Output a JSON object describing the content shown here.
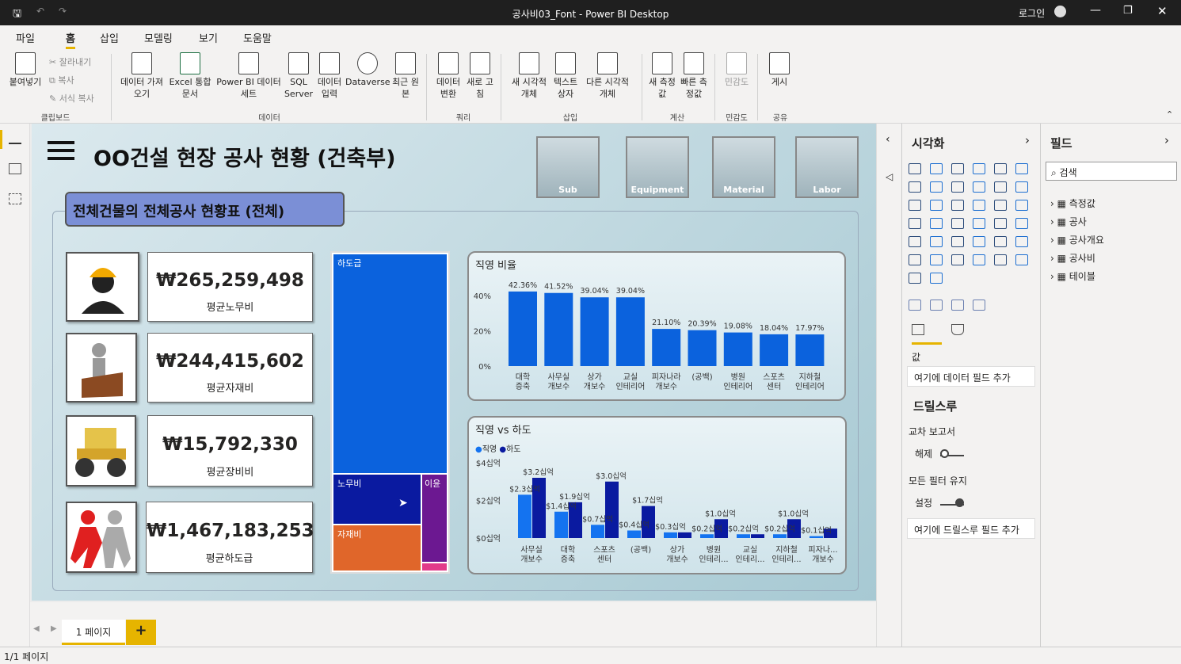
{
  "window": {
    "title": "공사비03_Font - Power BI Desktop",
    "login": "로그인"
  },
  "menu": [
    "파일",
    "홈",
    "삽입",
    "모델링",
    "보기",
    "도움말"
  ],
  "ribbon": {
    "paste": "붙여넣기",
    "cut": "잘라내기",
    "copy": "복사",
    "format_copy": "서식 복사",
    "get_data": "데이터 가져오기",
    "excel": "Excel 통합 문서",
    "pbi_dataset": "Power BI 데이터 세트",
    "sql": "SQL Server",
    "enter_data": "데이터 입력",
    "dataverse": "Dataverse",
    "recent": "최근 원본",
    "transform": "데이터 변환",
    "refresh": "새로 고침",
    "new_visual": "새 시각적 개체",
    "textbox": "텍스트 상자",
    "more_visuals": "다른 시각적 개체",
    "new_measure": "새 측정값",
    "quick_measure": "빠른 측정값",
    "sensitivity": "민감도",
    "publish": "게시",
    "groups": [
      "클립보드",
      "데이터",
      "쿼리",
      "삽입",
      "계산",
      "민감도",
      "공유"
    ]
  },
  "report": {
    "title": "OO건설 현장 공사 현황 (건축부)",
    "subtitle": "전체건물의 전체공사 현황표 (전체)",
    "nav_buttons": [
      "Sub",
      "Equipment",
      "Material",
      "Labor"
    ],
    "kpis": [
      {
        "value": "₩265,259,498",
        "label": "평균노무비"
      },
      {
        "value": "₩244,415,602",
        "label": "평균자재비"
      },
      {
        "value": "₩15,792,330",
        "label": "평균장비비"
      },
      {
        "value": "₩1,467,183,253",
        "label": "평균하도급"
      }
    ],
    "treemap": {
      "labels": [
        "하도급",
        "노무비",
        "이윤",
        "자재비"
      ]
    }
  },
  "chart_data": [
    {
      "type": "bar",
      "title": "직영 비율",
      "categories": [
        "대학 증축",
        "사무실 개보수",
        "상가 개보수",
        "교실 인테리어",
        "피자나라 개보수",
        "(공백)",
        "병원 인테리어",
        "스포츠 센터",
        "지하철 인테리어"
      ],
      "values": [
        42.36,
        41.52,
        39.04,
        39.04,
        21.1,
        20.39,
        19.08,
        18.04,
        17.97
      ],
      "data_labels": [
        "42.36%",
        "41.52%",
        "39.04%",
        "39.04%",
        "21.10%",
        "20.39%",
        "19.08%",
        "18.04%",
        "17.97%"
      ],
      "yticks": [
        "40%",
        "20%",
        "0%"
      ],
      "ylim": [
        0,
        45
      ],
      "color": "#0b62dd"
    },
    {
      "type": "bar",
      "title": "직영 vs 하도",
      "categories": [
        "사무실 개보수",
        "대학 증축",
        "스포츠 센터",
        "(공백)",
        "상가 개보수",
        "병원 인테리...",
        "교실 인테리...",
        "지하철 인테리...",
        "피자나... 개보수"
      ],
      "series": [
        {
          "name": "직영",
          "values": [
            2.3,
            1.4,
            0.7,
            0.4,
            0.3,
            0.2,
            0.2,
            0.2,
            0.1
          ],
          "color": "#1473f0"
        },
        {
          "name": "하도",
          "values": [
            3.2,
            1.9,
            3.0,
            1.7,
            0.3,
            1.0,
            0.2,
            1.0,
            0.5
          ],
          "color": "#0a1aa0"
        }
      ],
      "labels_a": [
        "$2.3십억",
        "$1.4십억",
        "$0.7십억",
        "$0.4십억",
        "$0.3십억",
        "$0.2십억",
        "$0.2십억",
        "$0.2십억",
        "$0.1십억"
      ],
      "labels_b": [
        "$3.2십억",
        "$1.9십억",
        "$3.0십억",
        "$1.7십억",
        "",
        "$1.0십억",
        "",
        "$1.0십억",
        ""
      ],
      "yticks": [
        "$4십억",
        "$2십억",
        "$0십억"
      ],
      "ylim": [
        0,
        4
      ]
    }
  ],
  "vis_panel": {
    "title": "시각화",
    "value_label": "값",
    "add_field": "여기에 데이터 필드 추가",
    "drill": "드릴스루",
    "cross": "교차 보고서",
    "cross_state": "해제",
    "keep": "모든 필터 유지",
    "keep_state": "설정",
    "add_drill": "여기에 드릴스루 필드 추가"
  },
  "field_panel": {
    "title": "필드",
    "search": "검색",
    "items": [
      "측정값",
      "공사",
      "공사개요",
      "공사비",
      "테이블"
    ]
  },
  "pages": {
    "tab": "1 페이지",
    "add": "+",
    "status": "1/1 페이지"
  }
}
